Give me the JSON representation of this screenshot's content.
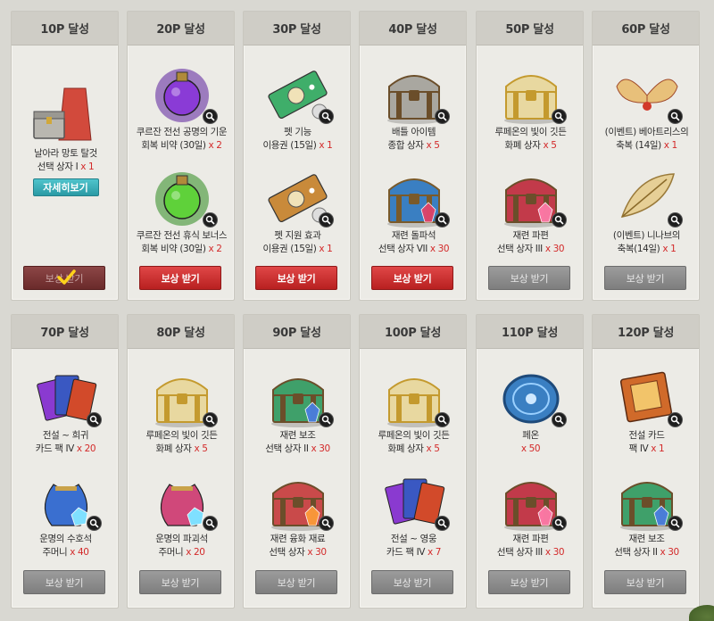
{
  "colors": {
    "background": "#d9d8d2",
    "card": "#ecebe6",
    "header": "#cfcdc6",
    "quantity": "#d32a2a",
    "button_active": "#d03434",
    "button_disabled": "#8a8a8a",
    "button_claimed": "#7a3535",
    "detail_button": "#3cb0b9"
  },
  "tiers": [
    {
      "title": "10P 달성",
      "items": [
        {
          "line1": "날아라 망토 탈것",
          "line2": "선택 상자 I",
          "qty": "x 1",
          "icon": "cape-and-chest-icon"
        }
      ],
      "detail_label": "자세히보기",
      "button": "보상 받기",
      "state": "claimed"
    },
    {
      "title": "20P 달성",
      "items": [
        {
          "line1": "쿠르잔 전선 공명의 기운",
          "line2": "회복 비약 (30일)",
          "qty": "x 2",
          "icon": "purple-potion-icon"
        },
        {
          "line1": "쿠르잔 전선 휴식 보너스",
          "line2": "회복 비약 (30일)",
          "qty": "x 2",
          "icon": "green-potion-icon"
        }
      ],
      "button": "보상 받기",
      "state": "active"
    },
    {
      "title": "30P 달성",
      "items": [
        {
          "line1": "펫 기능",
          "line2": "이용권 (15일)",
          "qty": "x 1",
          "icon": "green-ticket-icon"
        },
        {
          "line1": "펫 지원 효과",
          "line2": "이용권 (15일)",
          "qty": "x 1",
          "icon": "orange-ticket-icon"
        }
      ],
      "button": "보상 받기",
      "state": "active"
    },
    {
      "title": "40P 달성",
      "items": [
        {
          "line1": "배틀 아이템",
          "line2": "종합 상자",
          "qty": "x 5",
          "icon": "battle-chest-icon"
        },
        {
          "line1": "재련 돌파석",
          "line2": "선택 상자 VII",
          "qty": "x 30",
          "icon": "blue-chest-icon"
        }
      ],
      "button": "보상 받기",
      "state": "active"
    },
    {
      "title": "50P 달성",
      "items": [
        {
          "line1": "루페온의 빛이 깃든",
          "line2": "화폐 상자",
          "qty": "x 5",
          "icon": "gold-chest-icon"
        },
        {
          "line1": "재련 파편",
          "line2": "선택 상자 III",
          "qty": "x 30",
          "icon": "red-chest-icon"
        }
      ],
      "button": "보상 받기",
      "state": "disabled"
    },
    {
      "title": "60P 달성",
      "items": [
        {
          "line1": "(이벤트) 베아트리스의",
          "line2": "축복 (14일)",
          "qty": "x 1",
          "icon": "wings-icon"
        },
        {
          "line1": "(이벤트) 니나브의",
          "line2": "축복(14일)",
          "qty": "x 1",
          "icon": "feather-icon"
        }
      ],
      "button": "보상 받기",
      "state": "disabled"
    },
    {
      "title": "70P 달성",
      "items": [
        {
          "line1": "전설 ~ 희귀",
          "line2": "카드 팩 IV",
          "qty": "x 20",
          "icon": "card-pack-icon"
        },
        {
          "line1": "운명의 수호석",
          "line2": "주머니",
          "qty": "x 40",
          "icon": "blue-pouch-icon"
        }
      ],
      "button": "보상 받기",
      "state": "disabled"
    },
    {
      "title": "80P 달성",
      "items": [
        {
          "line1": "루페온의 빛이 깃든",
          "line2": "화폐 상자",
          "qty": "x 5",
          "icon": "gold-chest-icon"
        },
        {
          "line1": "운명의 파괴석",
          "line2": "주머니",
          "qty": "x 20",
          "icon": "pink-pouch-icon"
        }
      ],
      "button": "보상 받기",
      "state": "disabled"
    },
    {
      "title": "90P 달성",
      "items": [
        {
          "line1": "재련 보조",
          "line2": "선택 상자 II",
          "qty": "x 30",
          "icon": "green-chest-icon"
        },
        {
          "line1": "재련 융화 재료",
          "line2": "선택 상자",
          "qty": "x 30",
          "icon": "fusion-chest-icon"
        }
      ],
      "button": "보상 받기",
      "state": "disabled"
    },
    {
      "title": "100P 달성",
      "items": [
        {
          "line1": "루페온의 빛이 깃든",
          "line2": "화폐 상자",
          "qty": "x 5",
          "icon": "gold-chest-icon"
        },
        {
          "line1": "전설 ~ 영웅",
          "line2": "카드 팩 IV",
          "qty": "x 7",
          "icon": "card-pack-icon"
        }
      ],
      "button": "보상 받기",
      "state": "disabled"
    },
    {
      "title": "110P 달성",
      "items": [
        {
          "line1": "페온",
          "line2": "",
          "qty": "x 50",
          "icon": "pheon-coin-icon"
        },
        {
          "line1": "재련 파편",
          "line2": "선택 상자 III",
          "qty": "x 30",
          "icon": "red-chest-icon"
        }
      ],
      "button": "보상 받기",
      "state": "disabled"
    },
    {
      "title": "120P 달성",
      "items": [
        {
          "line1": "전설 카드",
          "line2": "팩 IV",
          "qty": "x 1",
          "icon": "legend-card-book-icon"
        },
        {
          "line1": "재련 보조",
          "line2": "선택 상자 II",
          "qty": "x 30",
          "icon": "green-chest-icon"
        }
      ],
      "button": "보상 받기",
      "state": "disabled"
    }
  ]
}
